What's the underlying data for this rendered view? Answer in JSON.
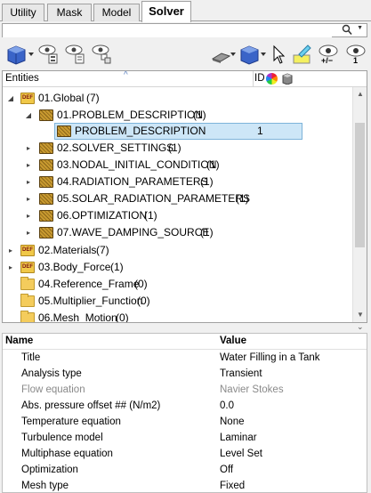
{
  "tabs": [
    {
      "label": "Utility"
    },
    {
      "label": "Mask"
    },
    {
      "label": "Model"
    },
    {
      "label": "Solver"
    }
  ],
  "search": {
    "value": "",
    "placeholder": ""
  },
  "icons": {
    "search": "magnifier-icon",
    "toolbar": [
      "entity-view-icon",
      "show-ids-icon",
      "show-all-icon",
      "isolate-icon",
      "eraser-icon",
      "entity-color-icon",
      "pointer-icon",
      "highlight-icon",
      "toggle-visibility-icon",
      "isolate-visible-icon"
    ]
  },
  "toolbar_labels": {
    "plusminus": "+/−",
    "one": "1"
  },
  "tree": {
    "header": {
      "entities": "Entities",
      "id": "ID"
    },
    "rows": [
      {
        "label": "01.Global",
        "count": "(7)",
        "id": ""
      },
      {
        "label": "01.PROBLEM_DESCRIPTION",
        "count": "(1)",
        "id": ""
      },
      {
        "label": "PROBLEM_DESCRIPTION",
        "count": "",
        "id": "1"
      },
      {
        "label": "02.SOLVER_SETTINGS",
        "count": "(1)",
        "id": ""
      },
      {
        "label": "03.NODAL_INITIAL_CONDITION",
        "count": "(1)",
        "id": ""
      },
      {
        "label": "04.RADIATION_PARAMETERS",
        "count": "(1)",
        "id": ""
      },
      {
        "label": "05.SOLAR_RADIATION_PARAMETERS",
        "count": "(1)",
        "id": ""
      },
      {
        "label": "06.OPTIMIZATION",
        "count": "(1)",
        "id": ""
      },
      {
        "label": "07.WAVE_DAMPING_SOURCE",
        "count": "(1)",
        "id": ""
      },
      {
        "label": "02.Materials",
        "count": "(7)",
        "id": ""
      },
      {
        "label": "03.Body_Force",
        "count": "(1)",
        "id": ""
      },
      {
        "label": "04.Reference_Frame",
        "count": "(0)",
        "id": ""
      },
      {
        "label": "05.Multiplier_Function",
        "count": "(0)",
        "id": ""
      },
      {
        "label": "06.Mesh_Motion",
        "count": "(0)",
        "id": ""
      }
    ]
  },
  "properties": {
    "header": {
      "name": "Name",
      "value": "Value"
    },
    "rows": [
      {
        "name": "Title",
        "value": "Water Filling in a Tank"
      },
      {
        "name": "Analysis type",
        "value": "Transient"
      },
      {
        "name": "Flow equation",
        "value": "Navier Stokes"
      },
      {
        "name": "Abs. pressure offset ## (N/m2)",
        "value": "0.0"
      },
      {
        "name": "Temperature equation",
        "value": "None"
      },
      {
        "name": "Turbulence model",
        "value": "Laminar"
      },
      {
        "name": "Multiphase equation",
        "value": "Level Set"
      },
      {
        "name": "Optimization",
        "value": "Off"
      },
      {
        "name": "Mesh type",
        "value": "Fixed"
      }
    ]
  },
  "colors": {
    "selection": "#cde6f7",
    "selection_border": "#7db3d9",
    "folder": "#f0c848"
  }
}
